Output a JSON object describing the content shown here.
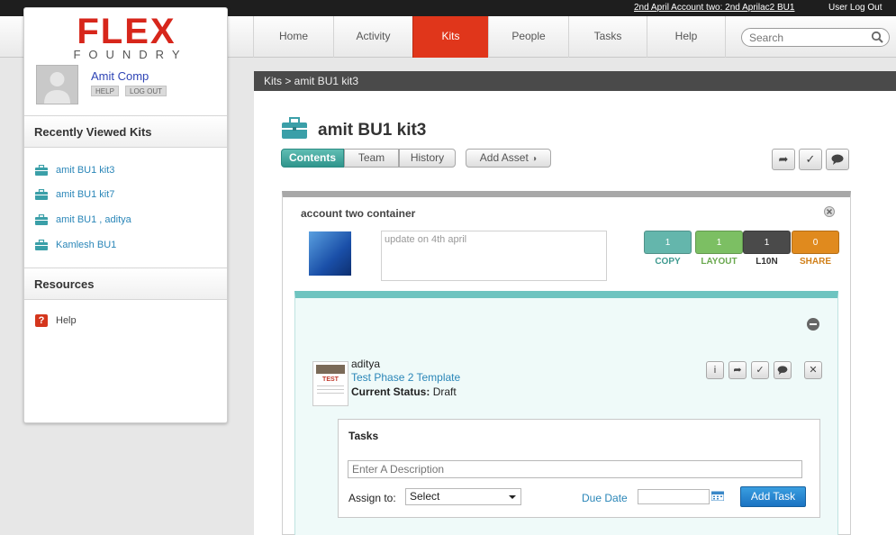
{
  "topbar": {
    "account_link": "2nd April Account two: 2nd Aprilac2 BU1",
    "logout": "User Log Out"
  },
  "nav": {
    "items": [
      "Home",
      "Activity",
      "Kits",
      "People",
      "Tasks",
      "Help"
    ],
    "active": "Kits",
    "search_placeholder": "Search"
  },
  "logo": {
    "line1": "FLEX",
    "line2": "FOUNDRY"
  },
  "user": {
    "name": "Amit Comp",
    "help": "HELP",
    "logout": "LOG OUT"
  },
  "sidebar": {
    "recent_heading": "Recently Viewed Kits",
    "recent_kits": [
      "amit BU1 kit3",
      "amit BU1 kit7",
      "amit BU1 , aditya",
      "Kamlesh BU1"
    ],
    "resources_heading": "Resources",
    "help_label": "Help"
  },
  "breadcrumb": "Kits > amit BU1 kit3",
  "page": {
    "title": "amit BU1 kit3",
    "tabs": [
      "Contents",
      "Team",
      "History"
    ],
    "active_tab": "Contents",
    "add_asset": "Add Asset"
  },
  "container": {
    "title": "account two container",
    "notes": "update on 4th april",
    "stats": [
      {
        "count": "1",
        "label": "COPY",
        "color": "#64b6ac"
      },
      {
        "count": "1",
        "label": "LAYOUT",
        "color": "#7cbf63"
      },
      {
        "count": "1",
        "label": "L10N",
        "color": "#4a4a4a"
      },
      {
        "count": "0",
        "label": "SHARE",
        "color": "#e08a1e"
      }
    ]
  },
  "asset": {
    "user": "aditya",
    "template": "Test Phase 2 Template",
    "status_label": "Current Status:",
    "status_value": "Draft",
    "thumb_text": "TEST"
  },
  "tasks": {
    "heading": "Tasks",
    "description_placeholder": "Enter A Description",
    "assign_label": "Assign to:",
    "assign_value": "Select",
    "due_label": "Due Date",
    "add_button": "Add Task"
  },
  "colors": {
    "brand_red": "#e0361b",
    "teal": "#2f958c",
    "link_blue": "#2a86b8",
    "button_blue": "#1a73c2"
  }
}
